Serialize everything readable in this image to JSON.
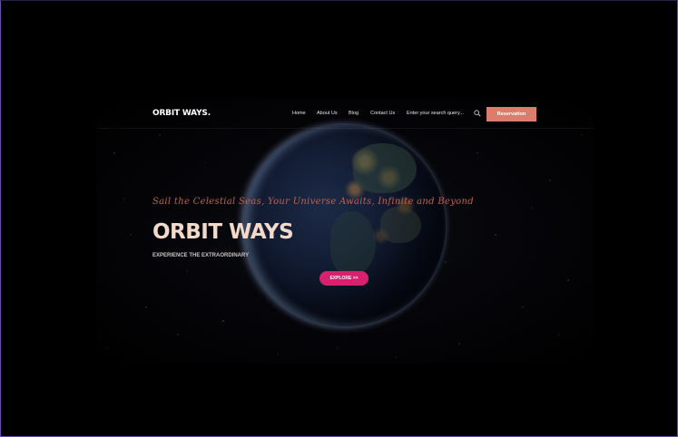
{
  "nav": {
    "brand": "ORBIT WAYS.",
    "links": [
      "Home",
      "About Us",
      "Blog",
      "Contact Us"
    ],
    "search_placeholder": "Enter your search query...",
    "search_icon": "search-icon",
    "reservation_label": "Reservation"
  },
  "hero": {
    "tagline": "Sail the Celestial Seas, Your Universe Awaits, Infinite and Beyond",
    "title": "ORBIT WAYS",
    "subtitle": "EXPERIENCE THE EXTRAORDINARY",
    "explore_label": "EXPLORE >>"
  },
  "colors": {
    "background": "#000000",
    "accent_reservation": "#dc7c6c",
    "accent_explore": "#d6216f",
    "tagline": "#c0624f",
    "title": "#f3d9c9"
  }
}
